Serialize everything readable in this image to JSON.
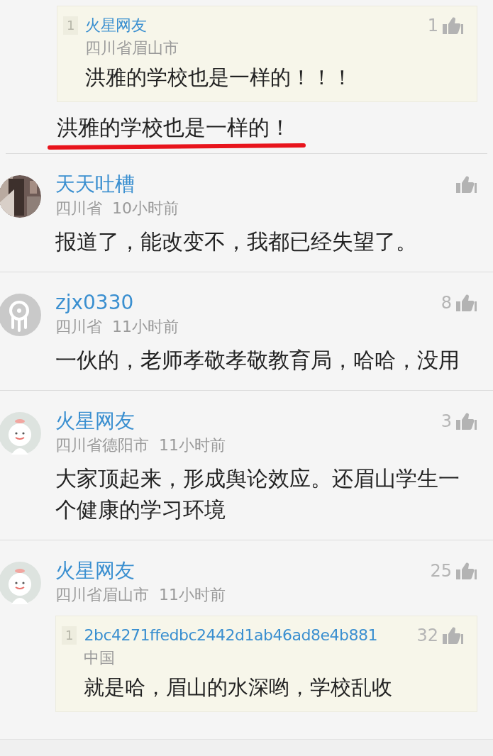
{
  "comments": [
    {
      "kind": "partial",
      "quote": {
        "index": "1",
        "name": "火星网友",
        "location": "四川省眉山市",
        "likes": "1",
        "body": "洪雅的学校也是一样的！！！"
      },
      "body": "洪雅的学校也是一样的！"
    },
    {
      "kind": "full",
      "name": "天天吐槽",
      "location": "四川省",
      "time": "10小时前",
      "body": "报道了，能改变不，我都已经失望了。"
    },
    {
      "kind": "full",
      "avatar": {
        "kind": "default"
      },
      "name": "zjx0330",
      "location": "四川省",
      "time": "11小时前",
      "likes": "8",
      "body": "一伙的，老师孝敬孝敬教育局，哈哈，没用"
    },
    {
      "kind": "full",
      "avatar": {
        "kind": "mascot"
      },
      "name": "火星网友",
      "location": "四川省德阳市",
      "time": "11小时前",
      "likes": "3",
      "body": "大家顶起来，形成舆论效应。还眉山学生一个健康的学习环境"
    },
    {
      "kind": "full",
      "avatar": {
        "kind": "mascot"
      },
      "name": "火星网友",
      "location": "四川省眉山市",
      "time": "11小时前",
      "likes": "25",
      "quote": {
        "index": "1",
        "name": "2bc4271ffedbc2442d1ab46ad8e4b881",
        "location": "中国",
        "likes": "32",
        "body": "就是哈，眉山的水深哟，学校乱收"
      }
    }
  ]
}
